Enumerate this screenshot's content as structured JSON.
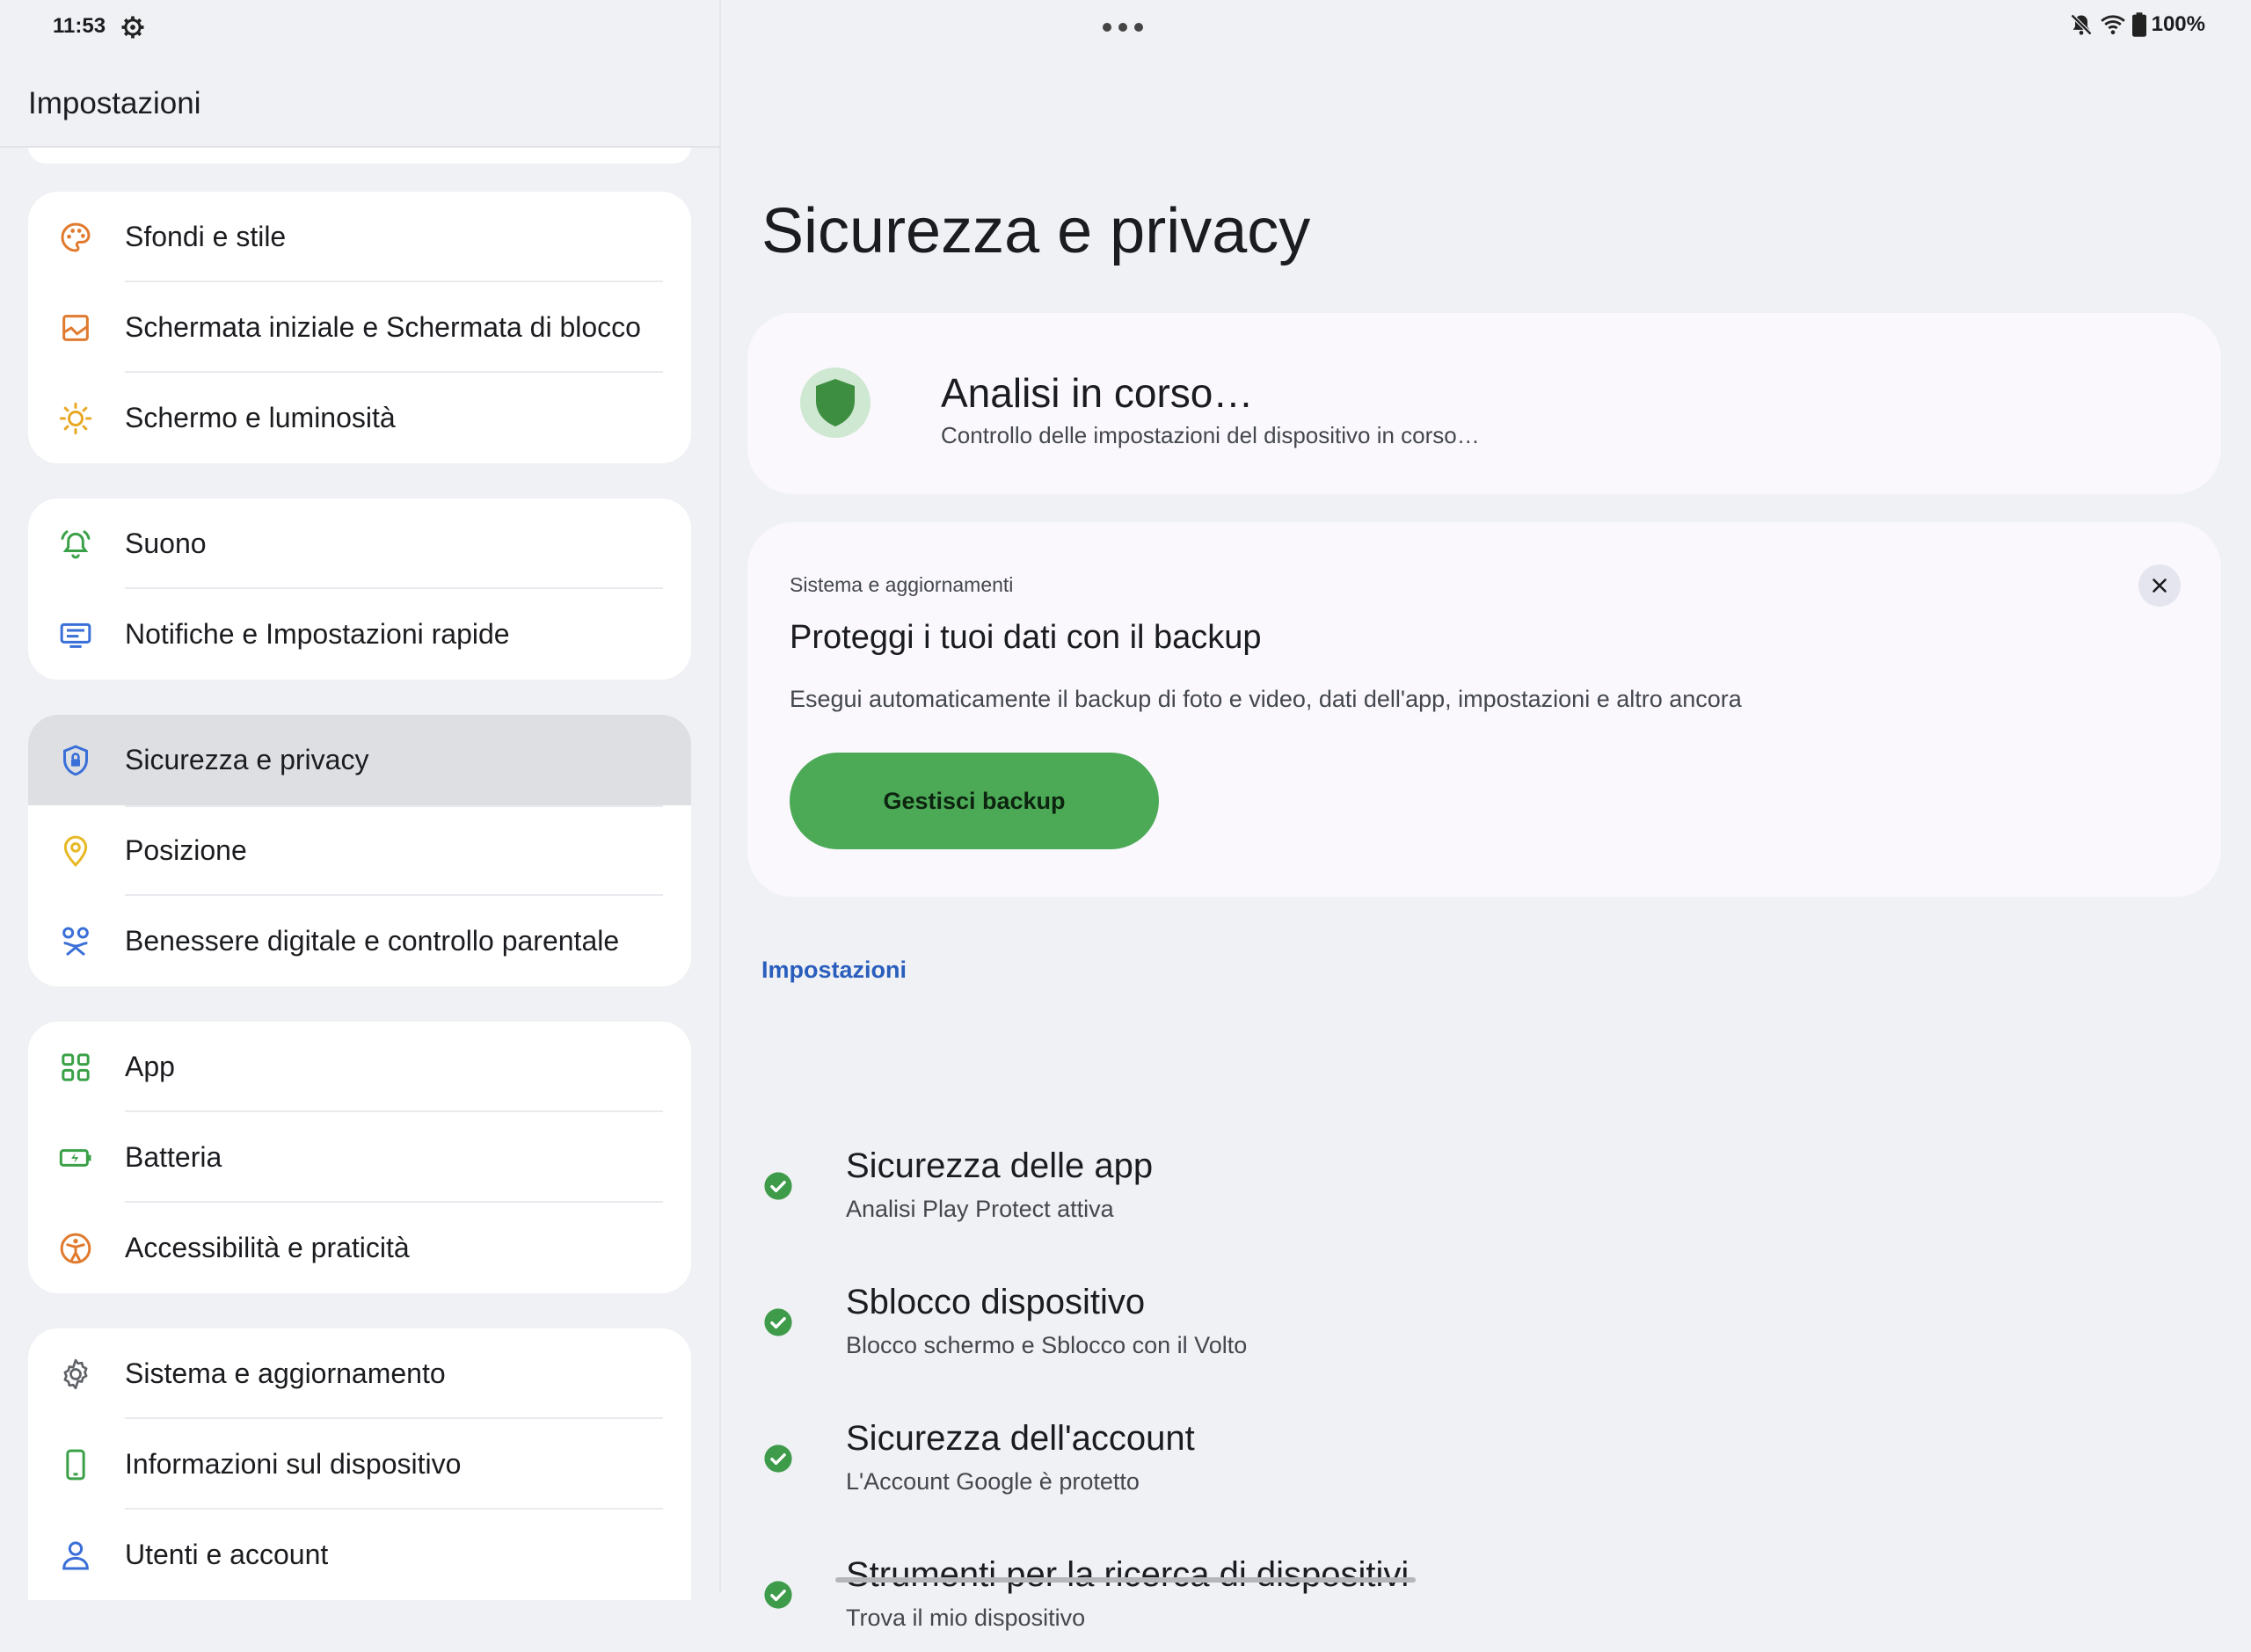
{
  "status_bar": {
    "time": "11:53",
    "battery": "100%",
    "icons": [
      "gear-icon",
      "overflow-dots-icon",
      "bell-off-icon",
      "wifi-icon",
      "battery-icon"
    ]
  },
  "left": {
    "title": "Impostazioni",
    "groups": [
      {
        "items": [
          {
            "label": "Sfondi e stile",
            "icon": "palette-icon",
            "color": "#e07a2e"
          },
          {
            "label": "Schermata iniziale e Schermata di blocco",
            "icon": "home-screen-icon",
            "color": "#e07a2e"
          },
          {
            "label": "Schermo e luminosità",
            "icon": "brightness-icon",
            "color": "#e8a825"
          }
        ]
      },
      {
        "items": [
          {
            "label": "Suono",
            "icon": "bell-ring-icon",
            "color": "#3aa148"
          },
          {
            "label": "Notifiche e Impostazioni rapide",
            "icon": "notifications-icon",
            "color": "#3a6fd8"
          }
        ]
      },
      {
        "items": [
          {
            "label": "Sicurezza e privacy",
            "icon": "security-shield-icon",
            "color": "#3a6fd8",
            "selected": true
          },
          {
            "label": "Posizione",
            "icon": "location-pin-icon",
            "color": "#e8b825"
          },
          {
            "label": "Benessere digitale e controllo parentale",
            "icon": "wellbeing-icon",
            "color": "#3a6fd8"
          }
        ]
      },
      {
        "items": [
          {
            "label": "App",
            "icon": "apps-grid-icon",
            "color": "#3aa148"
          },
          {
            "label": "Batteria",
            "icon": "battery-charging-icon",
            "color": "#3aa148"
          },
          {
            "label": "Accessibilità e praticità",
            "icon": "accessibility-icon",
            "color": "#e07a2e"
          }
        ]
      },
      {
        "items": [
          {
            "label": "Sistema e aggiornamento",
            "icon": "settings-gear-icon",
            "color": "#5f6368"
          },
          {
            "label": "Informazioni sul dispositivo",
            "icon": "device-phone-icon",
            "color": "#3aa148"
          },
          {
            "label": "Utenti e account",
            "icon": "person-icon",
            "color": "#3a6fd8"
          }
        ]
      }
    ]
  },
  "right": {
    "page_title": "Sicurezza e privacy",
    "status_card": {
      "title": "Analisi in corso…",
      "subtitle": "Controllo delle impostazioni del dispositivo in corso…",
      "shield_color": "#3e8e41"
    },
    "backup_card": {
      "overline": "Sistema e aggiornamenti",
      "title": "Proteggi i tuoi dati con il backup",
      "body": "Esegui automaticamente il backup di foto e video, dati dell'app, impostazioni e altro ancora",
      "button": "Gestisci backup",
      "button_color": "#4caa56"
    },
    "section_label": "Impostazioni",
    "items": [
      {
        "title": "Sicurezza delle app",
        "subtitle": "Analisi Play Protect attiva"
      },
      {
        "title": "Sblocco dispositivo",
        "subtitle": "Blocco schermo e Sblocco con il Volto"
      },
      {
        "title": "Sicurezza dell'account",
        "subtitle": "L'Account Google è protetto"
      },
      {
        "title": "Strumenti per la ricerca di dispositivi",
        "subtitle": "Trova il mio dispositivo"
      }
    ],
    "check_color": "#3e9b4a"
  }
}
